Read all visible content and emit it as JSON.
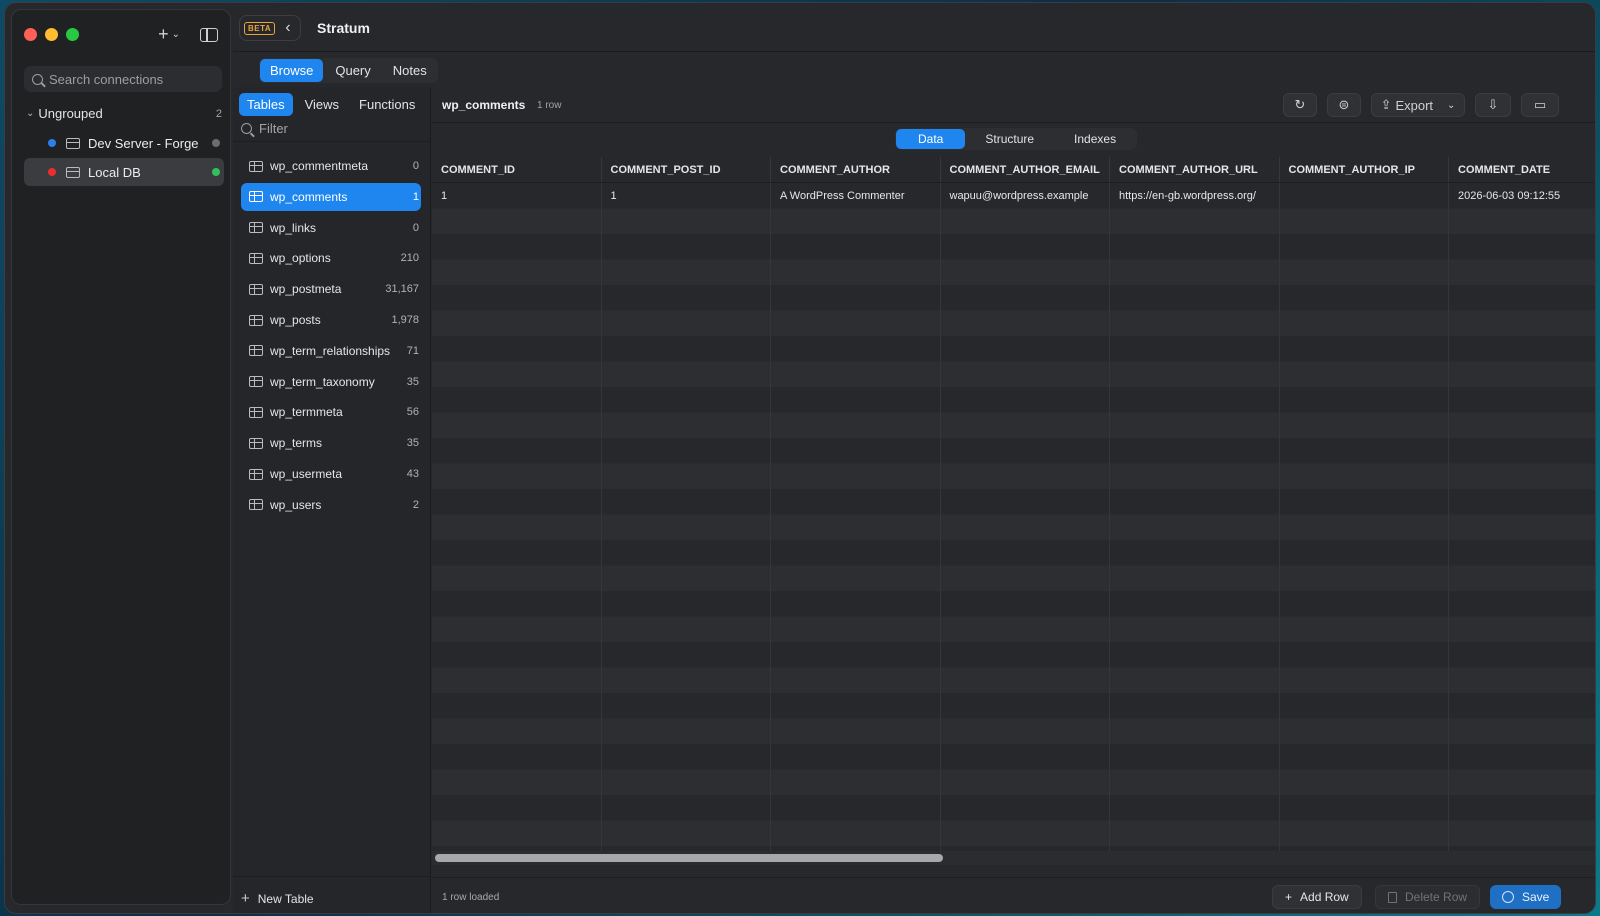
{
  "sidebar": {
    "search_placeholder": "Search connections",
    "group": {
      "label": "Ungrouped",
      "count": "2"
    },
    "connections": [
      {
        "label": "Dev Server - Forge",
        "color": "#2d7ee8",
        "status_color": "#6b6d71"
      },
      {
        "label": "Local DB",
        "color": "#e8302d",
        "status_color": "#2fc25a"
      }
    ]
  },
  "header": {
    "badge": "BETA",
    "title": "Stratum",
    "tabs": [
      "Browse",
      "Query",
      "Notes"
    ]
  },
  "tables_panel": {
    "tabs": [
      "Tables",
      "Views",
      "Functions"
    ],
    "filter_placeholder": "Filter",
    "items": [
      {
        "name": "wp_commentmeta",
        "count": "0"
      },
      {
        "name": "wp_comments",
        "count": "1"
      },
      {
        "name": "wp_links",
        "count": "0"
      },
      {
        "name": "wp_options",
        "count": "210"
      },
      {
        "name": "wp_postmeta",
        "count": "31,167"
      },
      {
        "name": "wp_posts",
        "count": "1,978"
      },
      {
        "name": "wp_term_relationships",
        "count": "71"
      },
      {
        "name": "wp_term_taxonomy",
        "count": "35"
      },
      {
        "name": "wp_termmeta",
        "count": "56"
      },
      {
        "name": "wp_terms",
        "count": "35"
      },
      {
        "name": "wp_usermeta",
        "count": "43"
      },
      {
        "name": "wp_users",
        "count": "2"
      }
    ],
    "new_table_label": "New Table"
  },
  "data_view": {
    "table_name": "wp_comments",
    "row_count": "1 row",
    "export_label": "Export",
    "view_tabs": [
      "Data",
      "Structure",
      "Indexes"
    ],
    "columns": [
      "COMMENT_ID",
      "COMMENT_POST_ID",
      "COMMENT_AUTHOR",
      "COMMENT_AUTHOR_EMAIL",
      "COMMENT_AUTHOR_URL",
      "COMMENT_AUTHOR_IP",
      "COMMENT_DATE"
    ],
    "rows": [
      [
        "1",
        "1",
        "A WordPress Commenter",
        "wapuu@wordpress.example",
        "https://en-gb.wordpress.org/",
        "",
        "2026-06-03 09:12:55"
      ]
    ],
    "loaded_text": "1 row loaded",
    "add_row_label": "Add Row",
    "delete_row_label": "Delete Row",
    "save_label": "Save"
  },
  "colors": {
    "accent": "#1f86f0",
    "save": "#1f6fc4"
  }
}
